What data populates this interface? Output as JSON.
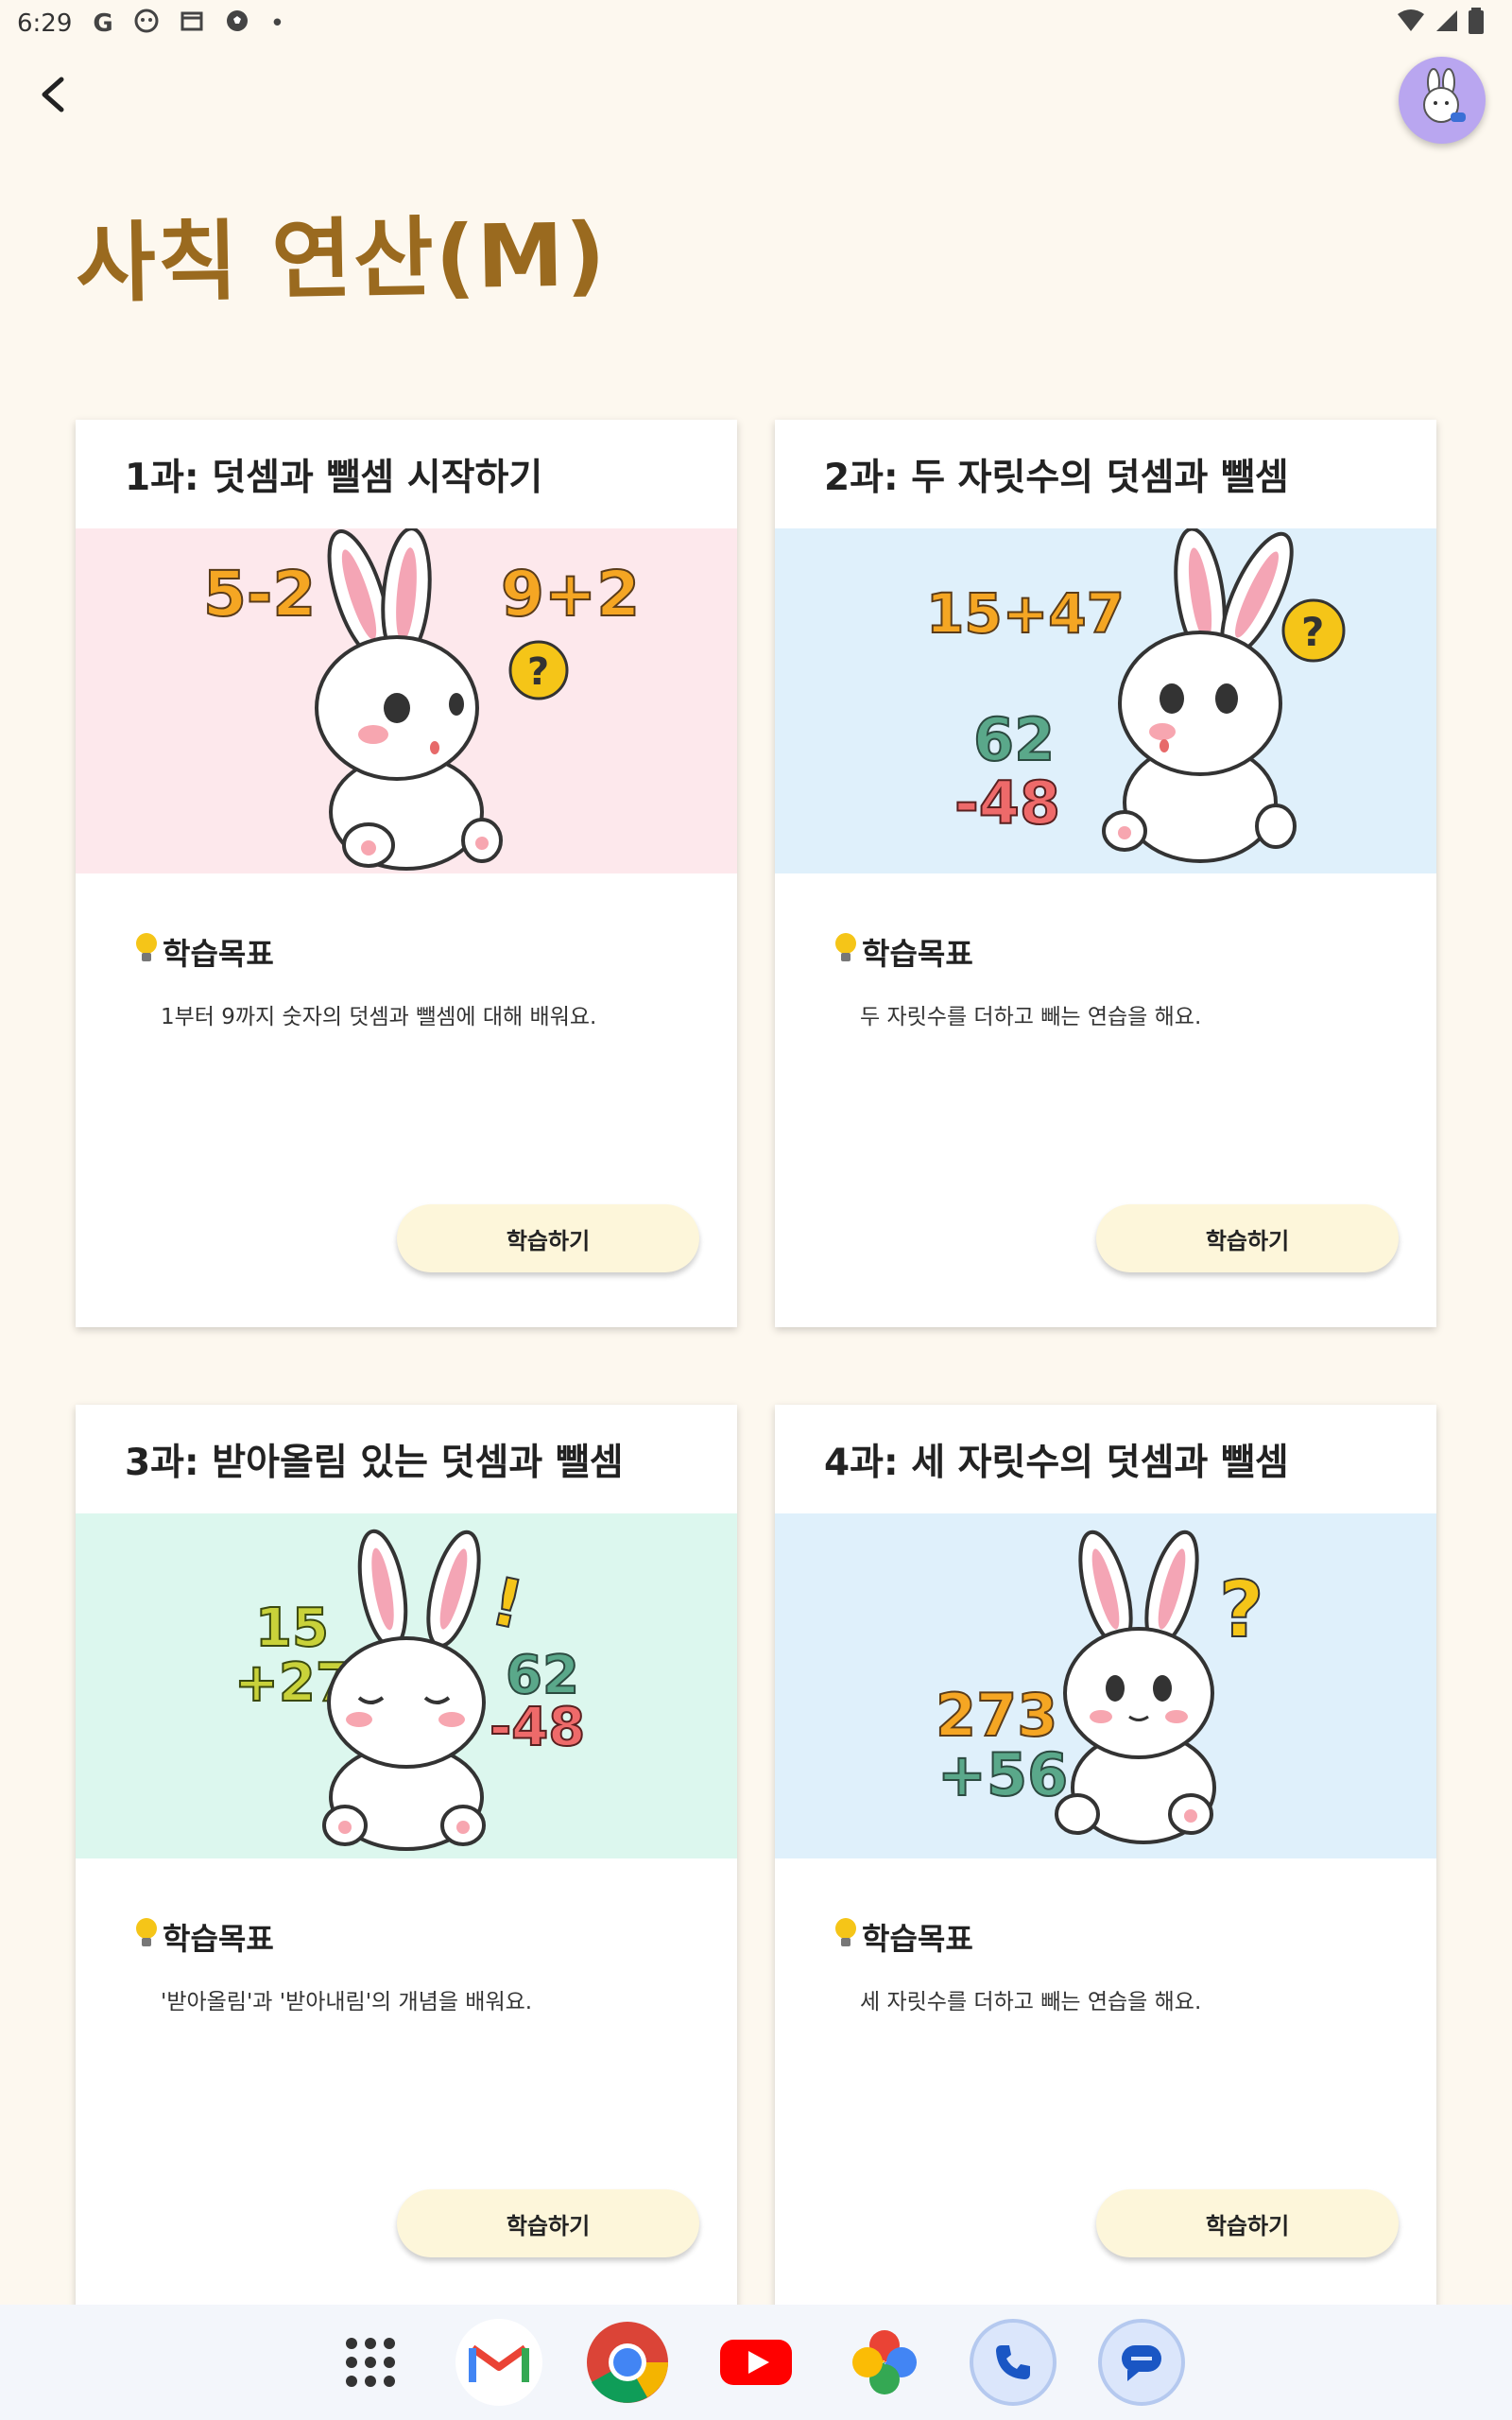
{
  "status": {
    "time": "6:29"
  },
  "header": {
    "title": "사칙 연산(M)"
  },
  "cards": [
    {
      "title": "1과: 덧셈과 뺄셈 시작하기",
      "goal_label": "학습목표",
      "goal_text": "1부터 9까지 숫자의 덧셈과 뺄셈에 대해 배워요.",
      "button": "학습하기",
      "bg": "#fde8ec",
      "eq1": "5-2",
      "eq2": "9+2",
      "eq3": "",
      "eq4": ""
    },
    {
      "title": "2과: 두 자릿수의 덧셈과 뺄셈",
      "goal_label": "학습목표",
      "goal_text": "두 자릿수를 더하고 빼는 연습을 해요.",
      "button": "학습하기",
      "bg": "#dff0fb",
      "eq1": "15+47",
      "eq2": "62",
      "eq3": "-48",
      "eq4": ""
    },
    {
      "title": "3과: 받아올림 있는 덧셈과 뺄셈",
      "goal_label": "학습목표",
      "goal_text": "'받아올림'과 '받아내림'의 개념을 배워요.",
      "button": "학습하기",
      "bg": "#dcf7ee",
      "eq1": "15",
      "eq2": "+27",
      "eq3": "62",
      "eq4": "-48"
    },
    {
      "title": "4과: 세 자릿수의 덧셈과 뺄셈",
      "goal_label": "학습목표",
      "goal_text": "세 자릿수를 더하고 빼는 연습을 해요.",
      "button": "학습하기",
      "bg": "#dff0fb",
      "eq1": "273",
      "eq2": "+56",
      "eq3": "",
      "eq4": ""
    }
  ],
  "colors": {
    "accent_title": "#9a6a1f",
    "num_orange": "#f5a623",
    "num_green": "#5aa88a",
    "num_red": "#ee6a6a",
    "button_bg": "#fdf6da"
  },
  "dock": [
    "apps-grid-icon",
    "gmail-icon",
    "chrome-icon",
    "youtube-icon",
    "photos-icon",
    "phone-icon",
    "messages-icon"
  ]
}
